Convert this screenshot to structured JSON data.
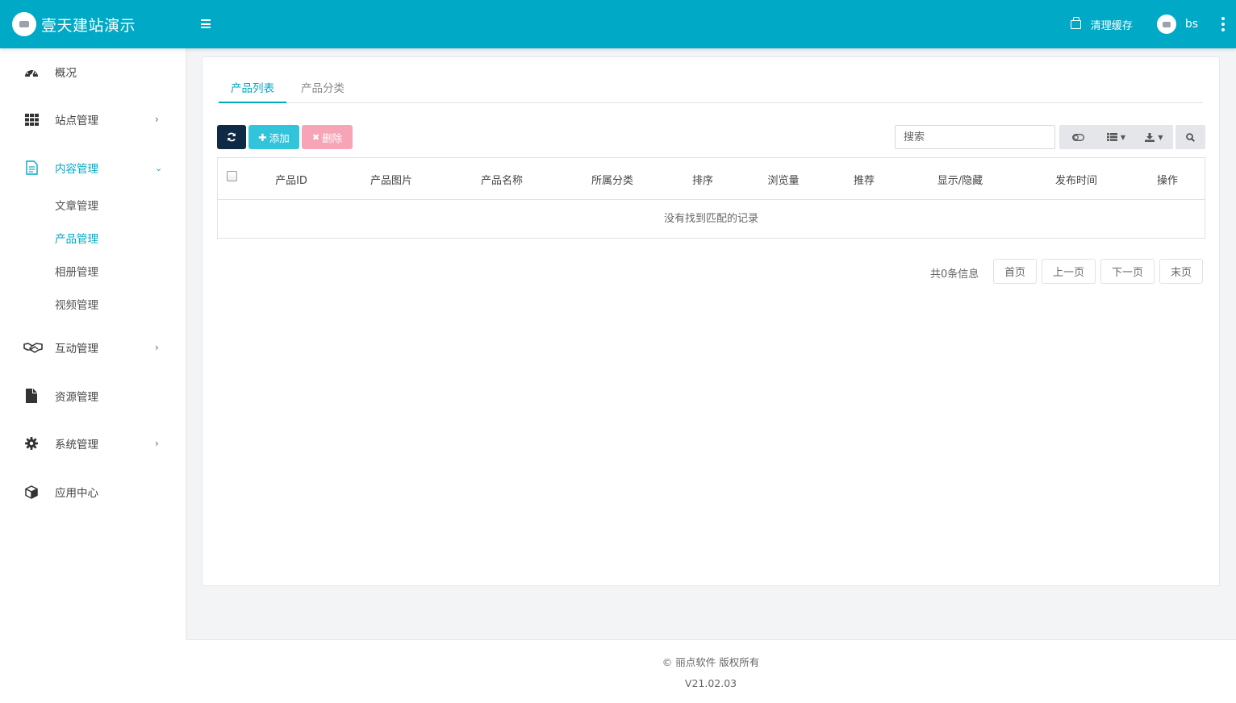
{
  "header": {
    "brand_title": "壹天建站演示",
    "clear_cache_label": "清理缓存",
    "username": "bs"
  },
  "colors": {
    "primary": "#00a9c5",
    "dark_button": "#0f2a45",
    "add_button": "#32c4da",
    "delete_button": "#f7a4b6"
  },
  "sidebar": {
    "items": [
      {
        "label": "概况",
        "icon": "dashboard-icon"
      },
      {
        "label": "站点管理",
        "icon": "grid-icon",
        "chevron": "›"
      },
      {
        "label": "内容管理",
        "icon": "document-icon",
        "chevron": "⌄",
        "active": true,
        "children": [
          {
            "label": "文章管理"
          },
          {
            "label": "产品管理",
            "active": true
          },
          {
            "label": "相册管理"
          },
          {
            "label": "视频管理"
          }
        ]
      },
      {
        "label": "互动管理",
        "icon": "handshake-icon",
        "chevron": "›"
      },
      {
        "label": "资源管理",
        "icon": "file-icon"
      },
      {
        "label": "系统管理",
        "icon": "gear-icon",
        "chevron": "›"
      },
      {
        "label": "应用中心",
        "icon": "cube-icon"
      }
    ]
  },
  "main": {
    "tabs": [
      {
        "label": "产品列表",
        "active": true
      },
      {
        "label": "产品分类"
      }
    ],
    "toolbar": {
      "add_label": "添加",
      "delete_label": "删除",
      "search_placeholder": "搜索"
    },
    "table": {
      "columns": [
        "产品ID",
        "产品图片",
        "产品名称",
        "所属分类",
        "排序",
        "浏览量",
        "推荐",
        "显示/隐藏",
        "发布时间",
        "操作"
      ],
      "empty_text": "没有找到匹配的记录"
    },
    "pagination": {
      "total_text": "共0条信息",
      "first": "首页",
      "prev": "上一页",
      "next": "下一页",
      "last": "末页"
    }
  },
  "footer": {
    "copyright": "© 丽点软件 版权所有",
    "version": "V21.02.03"
  }
}
